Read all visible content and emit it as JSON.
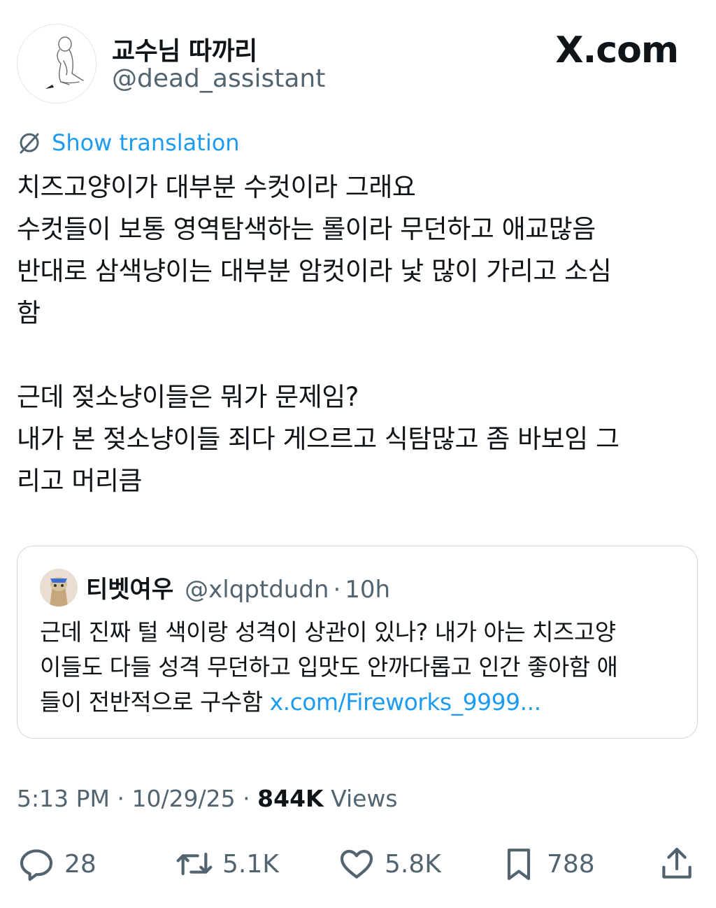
{
  "author": {
    "name": "교수님 따까리",
    "handle": "@dead_assistant"
  },
  "brand": "X.com",
  "translation_label": "Show translation",
  "tweet_text": "치즈고양이가 대부분 수컷이라 그래요\n수컷들이 보통 영역탐색하는 롤이라 무던하고 애교많음\n반대로 삼색냥이는 대부분 암컷이라 낯 많이 가리고 소심\n함\n\n근데 젖소냥이들은 뭐가 문제임?\n내가 본 젖소냥이들 죄다 게으르고 식탐많고 좀 바보임 그\n리고 머리큼",
  "quote": {
    "name": "티벳여우",
    "handle": "@xlqptdudn",
    "separator": "·",
    "time": "10h",
    "text": "근데 진짜 털 색이랑 성격이 상관이 있나? 내가 아는 치즈고양\n이들도 다들 성격 무던하고 입맛도 안까다롭고 인간 좋아함 애\n들이 전반적으로 구수함 ",
    "link": "x.com/Fireworks_9999..."
  },
  "meta": {
    "time": "5:13 PM",
    "separator": " · ",
    "date": "10/29/25",
    "views_count": "844K",
    "views_label": " Views"
  },
  "actions": {
    "replies": "28",
    "reposts": "5.1K",
    "likes": "5.8K",
    "bookmarks": "788"
  },
  "icons": {
    "reply": "reply-icon",
    "repost": "repost-icon",
    "like": "heart-icon",
    "bookmark": "bookmark-icon",
    "share": "share-icon",
    "translate": "translate-icon"
  },
  "colors": {
    "accent": "#1d9bf0",
    "muted": "#536471",
    "text": "#0f1419",
    "border": "#cfd9de"
  }
}
